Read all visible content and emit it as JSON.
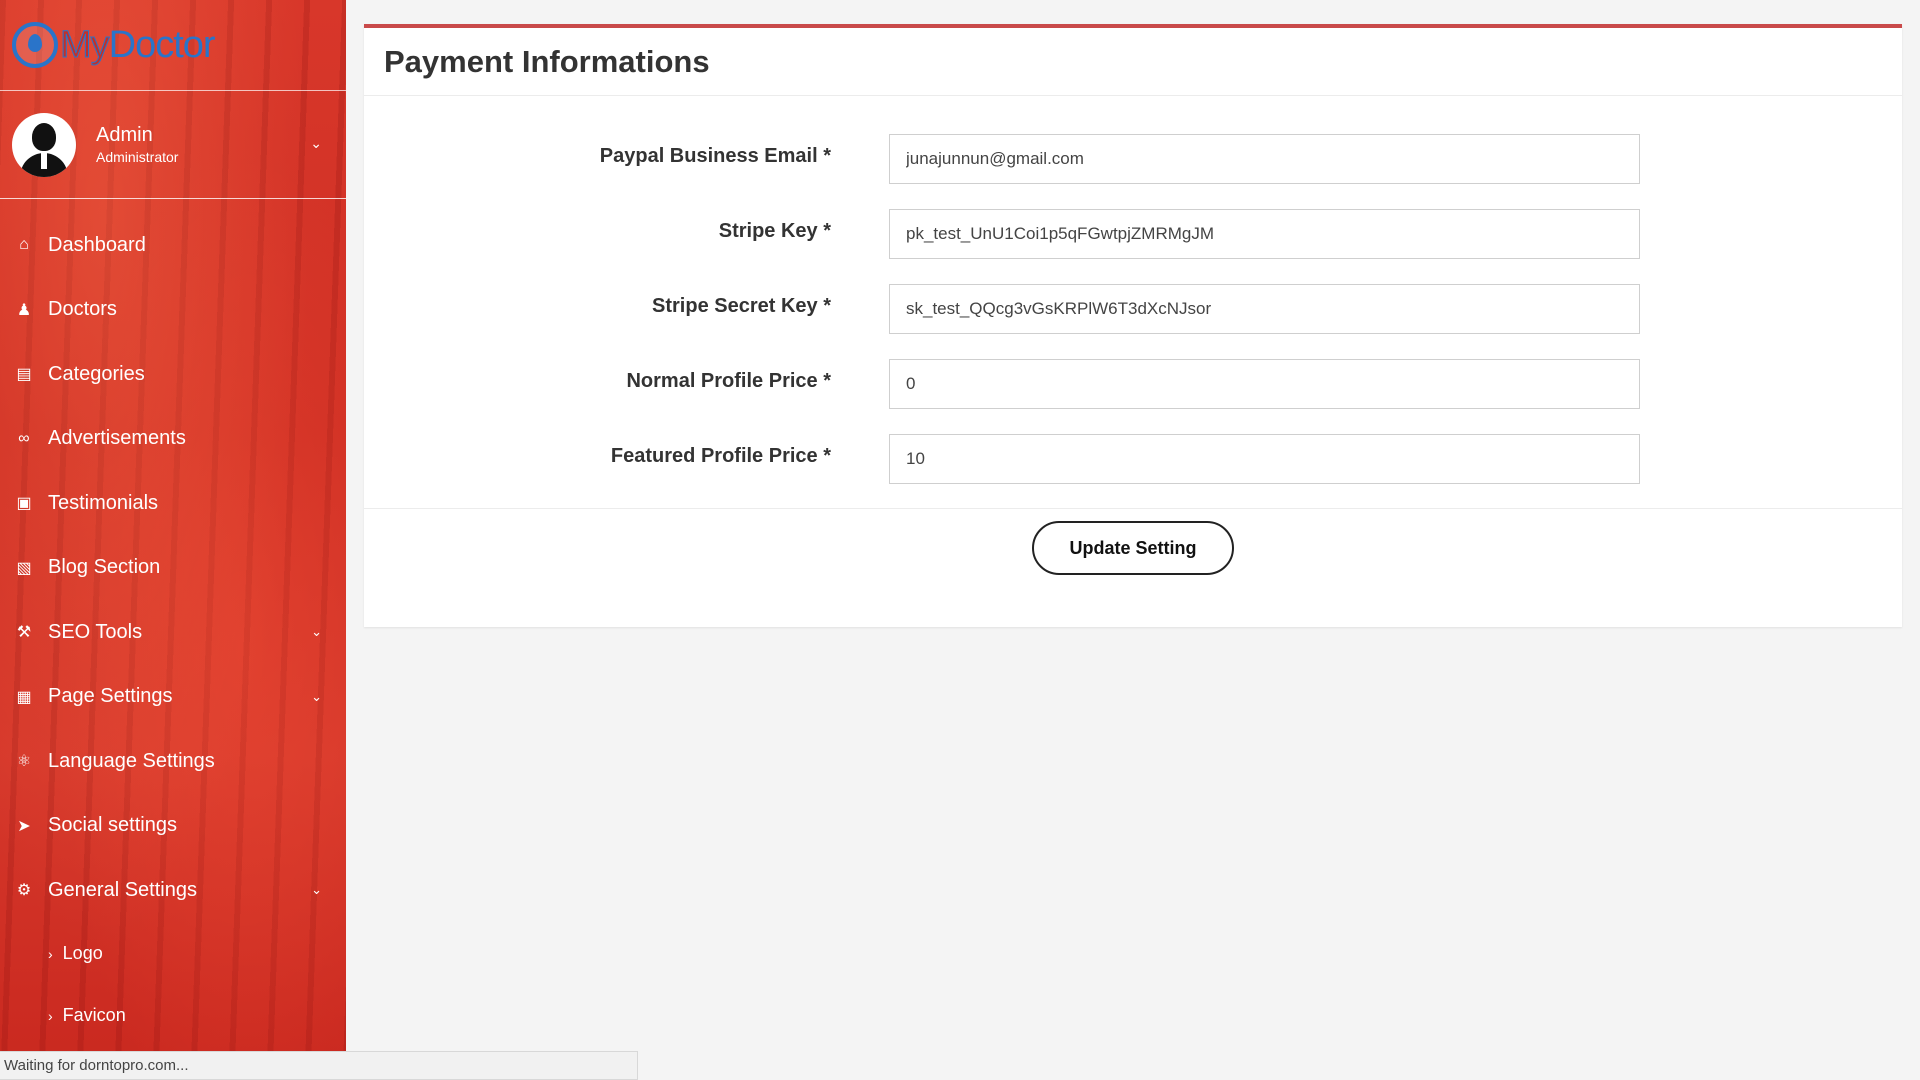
{
  "brand": {
    "part1": "My",
    "part2": "Doctor"
  },
  "user": {
    "name": "Admin",
    "role": "Administrator"
  },
  "sidebar": {
    "items": [
      {
        "label": "Dashboard",
        "icon": "home-icon"
      },
      {
        "label": "Doctors",
        "icon": "user-md-icon"
      },
      {
        "label": "Categories",
        "icon": "clipboard-icon"
      },
      {
        "label": "Advertisements",
        "icon": "link-icon"
      },
      {
        "label": "Testimonials",
        "icon": "image-icon"
      },
      {
        "label": "Blog Section",
        "icon": "file-icon"
      },
      {
        "label": "SEO Tools",
        "icon": "wrench-icon"
      },
      {
        "label": "Page Settings",
        "icon": "file-code-icon"
      },
      {
        "label": "Language Settings",
        "icon": "language-icon"
      },
      {
        "label": "Social settings",
        "icon": "paper-plane-icon"
      },
      {
        "label": "General Settings",
        "icon": "cogs-icon"
      }
    ],
    "sub_items": [
      {
        "label": "Logo"
      },
      {
        "label": "Favicon"
      }
    ]
  },
  "panel": {
    "title": "Payment Informations",
    "fields": [
      {
        "label": "Paypal Business Email *",
        "value": "junajunnun@gmail.com"
      },
      {
        "label": "Stripe Key *",
        "value": "pk_test_UnU1Coi1p5qFGwtpjZMRMgJM"
      },
      {
        "label": "Stripe Secret Key *",
        "value": "sk_test_QQcg3vGsKRPlW6T3dXcNJsor"
      },
      {
        "label": "Normal Profile Price *",
        "value": "0"
      },
      {
        "label": "Featured Profile Price *",
        "value": "10"
      }
    ],
    "submit_label": "Update Setting"
  },
  "status": {
    "text": "Waiting for dorntopro.com..."
  }
}
